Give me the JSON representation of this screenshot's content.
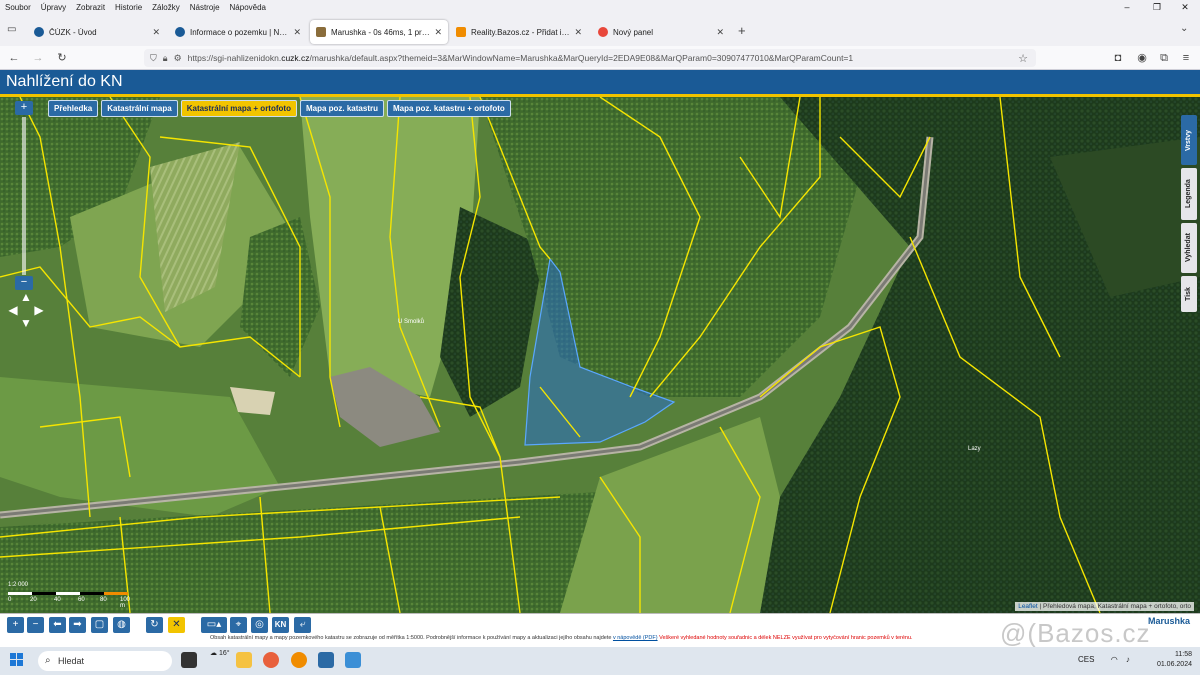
{
  "menubar": {
    "items": [
      "Soubor",
      "Úpravy",
      "Zobrazit",
      "Historie",
      "Záložky",
      "Nástroje",
      "Nápověda"
    ]
  },
  "tabs": [
    {
      "title": "ČÚZK - Úvod",
      "favicon_color": "#1a5a96"
    },
    {
      "title": "Informace o pozemku | Nahlíže",
      "favicon_color": "#1a5a96"
    },
    {
      "title": "Marushka - 0s 46ms, 1 prvků",
      "favicon_color": "#8a6d3b"
    },
    {
      "title": "Reality.Bazos.cz - Přidat inzerát",
      "favicon_color": "#f08c00"
    },
    {
      "title": "Nový panel",
      "favicon_color": "#e8473b"
    }
  ],
  "address": {
    "prefix": "https://sgi-nahlizenidokn.",
    "domain": "cuzk.cz",
    "rest": "/marushka/default.aspx?themeid=3&MarWindowName=Marushka&MarQueryId=2EDA9E08&MarQParam0=30907477010&MarQParamCount=1"
  },
  "app": {
    "title": "Nahlížení do KN",
    "accent": "#1a5a96",
    "highlight": "#f2c400"
  },
  "map_tabs": {
    "items": [
      "Přehledka",
      "Katastrální mapa",
      "Katastrální mapa + ortofoto",
      "Mapa poz. katastru",
      "Mapa poz. katastru + ortofoto"
    ],
    "selected": "Katastrální mapa + ortofoto"
  },
  "side_tabs": [
    "Vrstvy",
    "Legenda",
    "Vyhledat",
    "Tisk"
  ],
  "map_labels": {
    "locality": "U Smolků",
    "forest": "Lazy"
  },
  "scale": {
    "label": "1:2 000",
    "ticks": [
      "0",
      "20",
      "40",
      "60",
      "80",
      "100 m"
    ]
  },
  "attribution": {
    "link": "Leaflet",
    "text": " | Přehledová mapa, Katastrální mapa + ortofoto, orto"
  },
  "toolbar": {
    "brand": "Marushka",
    "notice_a": "Obsah katastrální mapy a mapy pozemkového katastru se zobrazuje od měřítka 1:5000. Podrobnější informace k používání mapy a aktualizaci jejího obsahu najdete",
    "notice_link": "v nápovědě (PDF)",
    "notice_b": "Veškeré vyhledané hodnoty souřadnic a délek NELZE využívat pro vytyčování hranic pozemků v terénu."
  },
  "watermark": "Bazos.cz",
  "taskbar": {
    "search": "Hledat",
    "weather": "16°",
    "lang": "CES",
    "time": "11:58",
    "date": "01.06.2024"
  }
}
